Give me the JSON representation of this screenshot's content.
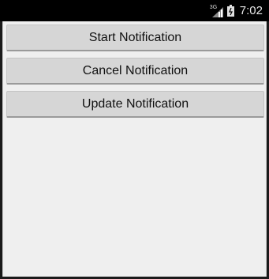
{
  "status_bar": {
    "network_type": "3G",
    "time": "7:02",
    "icons": [
      "signal-icon",
      "battery-icon"
    ]
  },
  "buttons": {
    "start_label": "Start Notification",
    "cancel_label": "Cancel Notification",
    "update_label": "Update Notification"
  },
  "colors": {
    "status_bar_bg": "#000000",
    "content_bg": "#efefef",
    "button_bg": "#d6d6d6",
    "text": "#111111"
  }
}
